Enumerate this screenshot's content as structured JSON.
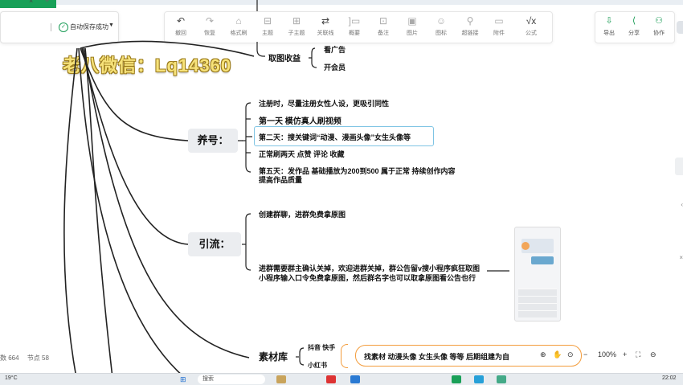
{
  "tab": {
    "close": "×",
    "add": "+"
  },
  "save": {
    "label": "自动保存成功"
  },
  "toolbar": {
    "items": [
      {
        "label": "撤回",
        "icon": "undo-icon"
      },
      {
        "label": "恢复",
        "icon": "redo-icon"
      },
      {
        "label": "格式刷",
        "icon": "format-brush-icon"
      },
      {
        "label": "主题",
        "icon": "topic-icon"
      },
      {
        "label": "子主题",
        "icon": "subtopic-icon"
      },
      {
        "label": "关联线",
        "icon": "relation-line-icon"
      },
      {
        "label": "概要",
        "icon": "summary-icon"
      },
      {
        "label": "备注",
        "icon": "note-icon"
      },
      {
        "label": "图片",
        "icon": "image-icon"
      },
      {
        "label": "图标",
        "icon": "emoji-icon"
      },
      {
        "label": "超链接",
        "icon": "link-icon"
      },
      {
        "label": "附件",
        "icon": "attachment-icon"
      },
      {
        "label": "公式",
        "icon": "formula-icon"
      }
    ]
  },
  "right_toolbar": {
    "export": "导出",
    "share": "分享",
    "collab": "协作"
  },
  "watermark": "老八微信：Lq14360",
  "map": {
    "branch_top": {
      "title": "取图收益",
      "items": [
        "看广告",
        "开会员"
      ]
    },
    "yanghao": {
      "title": "养号：",
      "items": [
        "注册时，尽量注册女性人设，更吸引同性",
        "第一天  模仿真人刷视频",
        "第二天：搜关键词“动漫、漫画头像”女生头像等",
        "正常刷两天    点赞  评论   收藏",
        "第五天：发作品    基础播放为200到500   属于正常   持续创作内容",
        "提高作品质量"
      ]
    },
    "yinliu": {
      "title": "引流：",
      "items": [
        "创建群聊，进群免费拿原图",
        "进群需要群主确认关掉，欢迎进群关掉，群公告留v搜小程序疯狂取图",
        "小程序输入口令免费拿原图，然后群名字也可以取拿原图看公告也行"
      ]
    },
    "sucai": {
      "title": "素材库",
      "items": [
        "抖音   快手",
        "小红书"
      ],
      "summary": "找素材    动漫头像    女生头像    等等     后期组建为自"
    }
  },
  "status": {
    "words": "数 664",
    "nodes": "节点 58"
  },
  "zoom": {
    "minus": "−",
    "value": "100%",
    "plus": "+"
  },
  "taskbar": {
    "temp": "19°C",
    "search": "搜索",
    "time": "22:02"
  }
}
